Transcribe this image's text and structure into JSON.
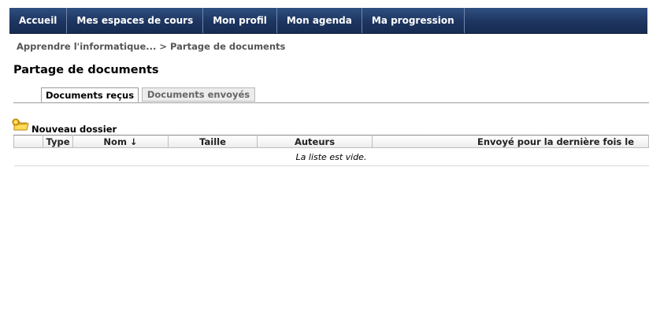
{
  "nav": {
    "items": [
      "Accueil",
      "Mes espaces de cours",
      "Mon profil",
      "Mon agenda",
      "Ma progression"
    ]
  },
  "breadcrumb": {
    "course": "Apprendre l'informatique...",
    "separator": ">",
    "current": "Partage de documents"
  },
  "page": {
    "title": "Partage de documents"
  },
  "tabs": {
    "received": "Documents reçus",
    "sent": "Documents envoyés"
  },
  "actions": {
    "new_folder_label": "Nouveau dossier",
    "new_folder_icon": "folder-add-icon"
  },
  "table": {
    "headers": {
      "type": "Type",
      "name": "Nom ↓",
      "size": "Taille",
      "authors": "Auteurs",
      "last_sent": "Envoyé pour la dernière fois le"
    },
    "empty_message": "La liste est vide."
  },
  "colors": {
    "nav_bg": "#1d3560",
    "nav_text": "#ffffff",
    "breadcrumb_text": "#555555"
  }
}
